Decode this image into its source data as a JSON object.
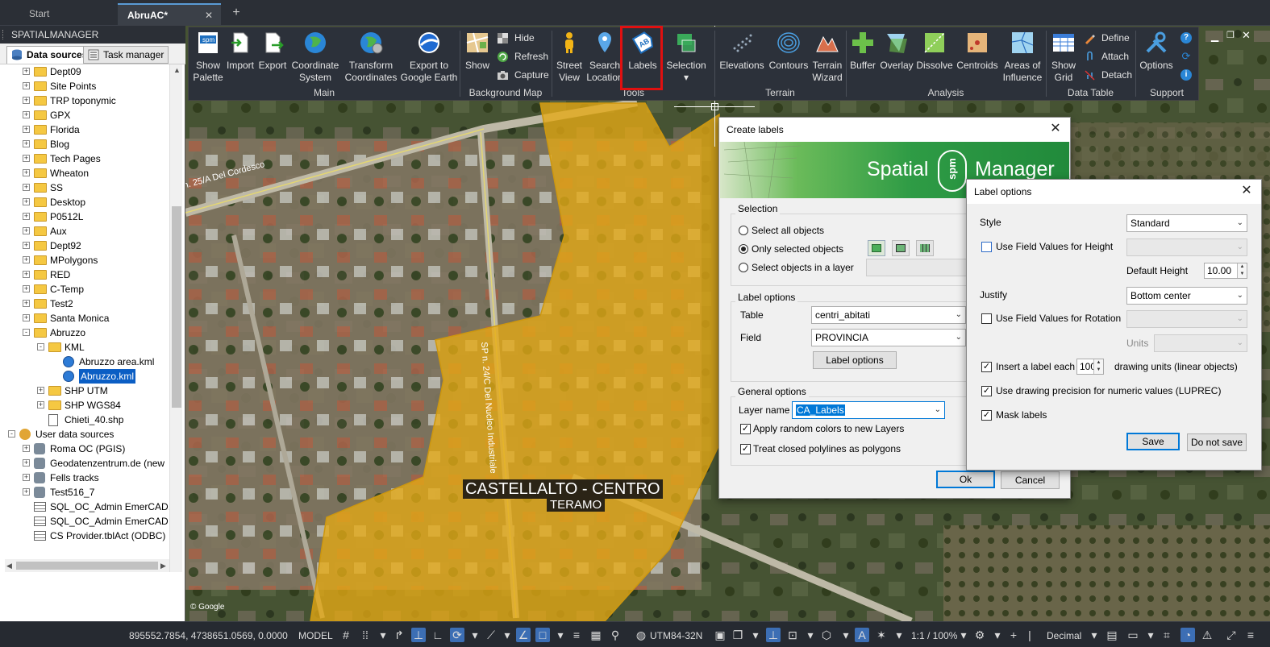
{
  "tabs": [
    {
      "label": "Start"
    },
    {
      "label": "AbruAC*"
    }
  ],
  "tab_close_glyph": "✕",
  "tab_add_glyph": "+",
  "panel": {
    "title": "SPATIALMANAGER",
    "tabs": [
      {
        "label": "Data sources"
      },
      {
        "label": "Task manager"
      }
    ]
  },
  "tree": [
    {
      "label": "Dept09"
    },
    {
      "label": "Site Points"
    },
    {
      "label": "TRP toponymic"
    },
    {
      "label": "GPX"
    },
    {
      "label": "Florida"
    },
    {
      "label": "Blog"
    },
    {
      "label": "Tech Pages"
    },
    {
      "label": "Wheaton"
    },
    {
      "label": "SS"
    },
    {
      "label": "Desktop"
    },
    {
      "label": "P0512L"
    },
    {
      "label": "Aux"
    },
    {
      "label": "Dept92"
    },
    {
      "label": "MPolygons"
    },
    {
      "label": "RED"
    },
    {
      "label": "C-Temp"
    },
    {
      "label": "Test2"
    },
    {
      "label": "Santa Monica"
    },
    {
      "label": "Abruzzo"
    },
    {
      "label": "KML"
    },
    {
      "label": "Abruzzo area.kml"
    },
    {
      "label": "Abruzzo.kml"
    },
    {
      "label": "SHP UTM"
    },
    {
      "label": "SHP WGS84"
    },
    {
      "label": "Chieti_40.shp"
    },
    {
      "label": "User data sources"
    },
    {
      "label": "Roma OC (PGIS)"
    },
    {
      "label": "Geodatenzentrum.de (new"
    },
    {
      "label": "Fells tracks"
    },
    {
      "label": "Test516_7"
    },
    {
      "label": "SQL_OC_Admin EmerCAD."
    },
    {
      "label": "SQL_OC_Admin EmerCAD"
    },
    {
      "label": "CS Provider.tblAct (ODBC)"
    }
  ],
  "ribbon": {
    "buttons": [
      {
        "label": "Show\nPalette",
        "icon": "palette-icon"
      },
      {
        "label": "Import",
        "icon": "import-icon"
      },
      {
        "label": "Export",
        "icon": "export-icon"
      },
      {
        "label": "Coordinate\nSystem",
        "icon": "globe-icon"
      },
      {
        "label": "Transform\nCoordinates",
        "icon": "transform-globe-icon"
      },
      {
        "label": "Export to\nGoogle Earth",
        "icon": "google-earth-icon"
      },
      {
        "label": "Show",
        "icon": "map-show-icon"
      },
      {
        "label": "Street\nView",
        "icon": "street-view-icon"
      },
      {
        "label": "Search\nLocation",
        "icon": "location-pin-icon"
      },
      {
        "label": "Labels",
        "icon": "labels-icon"
      },
      {
        "label": "Selection\n▾",
        "icon": "selection-icon"
      },
      {
        "label": "Elevations",
        "icon": "elevations-icon"
      },
      {
        "label": "Contours",
        "icon": "contours-icon"
      },
      {
        "label": "Terrain\nWizard",
        "icon": "terrain-icon"
      },
      {
        "label": "Buffer",
        "icon": "buffer-icon"
      },
      {
        "label": "Overlay",
        "icon": "overlay-icon"
      },
      {
        "label": "Dissolve",
        "icon": "dissolve-icon"
      },
      {
        "label": "Centroids",
        "icon": "centroids-icon"
      },
      {
        "label": "Areas of\nInfluence",
        "icon": "areas-influence-icon"
      },
      {
        "label": "Show\nGrid",
        "icon": "grid-icon"
      },
      {
        "label": "Options",
        "icon": "options-icon"
      }
    ],
    "small": [
      {
        "label": "Hide",
        "icon": "hide-icon"
      },
      {
        "label": "Refresh",
        "icon": "refresh-icon"
      },
      {
        "label": "Capture",
        "icon": "camera-icon"
      },
      {
        "label": "Define",
        "icon": "define-icon"
      },
      {
        "label": "Attach",
        "icon": "attach-icon"
      },
      {
        "label": "Detach",
        "icon": "detach-icon"
      }
    ],
    "groups": [
      {
        "label": "Main"
      },
      {
        "label": "Background Map"
      },
      {
        "label": "Tools"
      },
      {
        "label": "Terrain"
      },
      {
        "label": "Analysis"
      },
      {
        "label": "Data Table"
      },
      {
        "label": "Support"
      }
    ]
  },
  "map": {
    "road_labels": [
      {
        "text": "n. 25/A Del Cordesco"
      },
      {
        "text": "SP n. 24/C Del Nucleo Industriale"
      }
    ],
    "place_label": "CASTELLALTO - CENTRO",
    "province_label": "TERAMO",
    "attribution": "© Google"
  },
  "create_labels": {
    "title": "Create labels",
    "banner_text_left": "Spatial",
    "banner_logo": "spm",
    "banner_text_right": "Manager",
    "selection": {
      "legend": "Selection",
      "options": [
        {
          "label": "Select all objects",
          "checked": false
        },
        {
          "label": "Only selected objects",
          "checked": true
        },
        {
          "label": "Select objects in a layer",
          "checked": false
        }
      ]
    },
    "label_options": {
      "legend": "Label options",
      "table_label": "Table",
      "table_value": "centri_abitati",
      "field_label": "Field",
      "field_value": "PROVINCIA",
      "button": "Label options"
    },
    "general_options": {
      "legend": "General options",
      "layer_name_label": "Layer name",
      "layer_name_value": "CA_Labels",
      "checks": [
        {
          "label": "Apply random colors to new Layers",
          "checked": true
        },
        {
          "label": "Treat closed polylines as polygons",
          "checked": true
        }
      ]
    },
    "ok": "Ok",
    "cancel": "Cancel"
  },
  "label_opts_dialog": {
    "title": "Label options",
    "style_label": "Style",
    "style_value": "Standard",
    "height_field_label": "Use Field Values for Height",
    "height_field_checked": false,
    "default_height_label": "Default Height",
    "default_height_value": "10.00",
    "justify_label": "Justify",
    "justify_value": "Bottom center",
    "rotation_field_label": "Use Field Values for Rotation",
    "rotation_field_checked": false,
    "units_label": "Units",
    "insert_each_label": "Insert a label each",
    "insert_each_value": "100",
    "insert_each_suffix": "drawing units (linear objects)",
    "insert_each_checked": true,
    "luprec_label": "Use drawing precision for numeric values (LUPREC)",
    "luprec_checked": true,
    "mask_label": "Mask labels",
    "mask_checked": true,
    "save": "Save",
    "no_save": "Do not save"
  },
  "statusbar": {
    "coords": "895552.7854, 4738651.0569, 0.0000",
    "space": "MODEL",
    "cs": "UTM84-32N",
    "scale": "1:1 / 100%",
    "units": "Decimal"
  },
  "colors": {
    "accent": "#0078d7",
    "polygon": "#f2b416",
    "highlight": "#e01010",
    "selection": "#0b5ec4",
    "banner_green": "#2e9b45"
  }
}
